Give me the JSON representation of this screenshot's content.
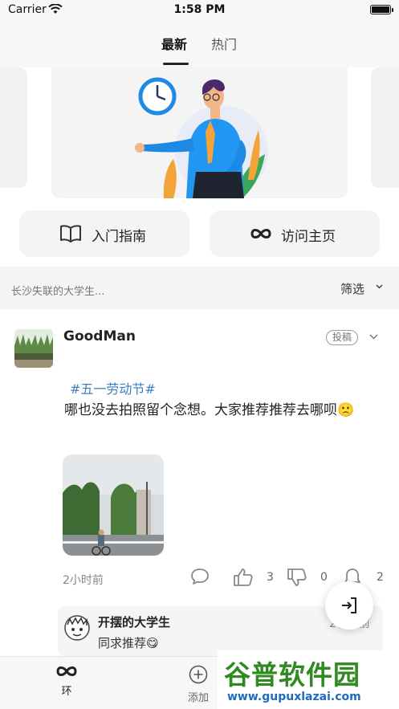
{
  "status_bar": {
    "carrier": "Carrier",
    "time": "1:58 PM"
  },
  "tabs": [
    {
      "label": "最新",
      "active": true
    },
    {
      "label": "热门",
      "active": false
    }
  ],
  "quick_actions": {
    "guide_label": "入门指南",
    "home_label": "访问主页"
  },
  "filter": {
    "current_user": "长沙失联的大学生...",
    "label": "筛选"
  },
  "post": {
    "username": "GoodMan",
    "badge": "投稿",
    "hashtag": "#五一劳动节#",
    "text": " 哪也没去拍照留个念想。大家推荐推荐去哪呗🙁",
    "time": "2小时前",
    "likes": "3",
    "dislikes": "0",
    "reminds": "2"
  },
  "comment": {
    "name": "开摆的大学生",
    "text": "同求推荐😋",
    "time": "2小时前"
  },
  "bottom_nav": {
    "ring_label": "环",
    "add_label": "添加"
  },
  "watermark": {
    "title": "谷普软件园",
    "url": "www.gupuxlazai.com"
  },
  "colors": {
    "accent": "#3d7fc1",
    "watermark_green": "#2f8a1f",
    "watermark_blue": "#1f6bbf"
  }
}
